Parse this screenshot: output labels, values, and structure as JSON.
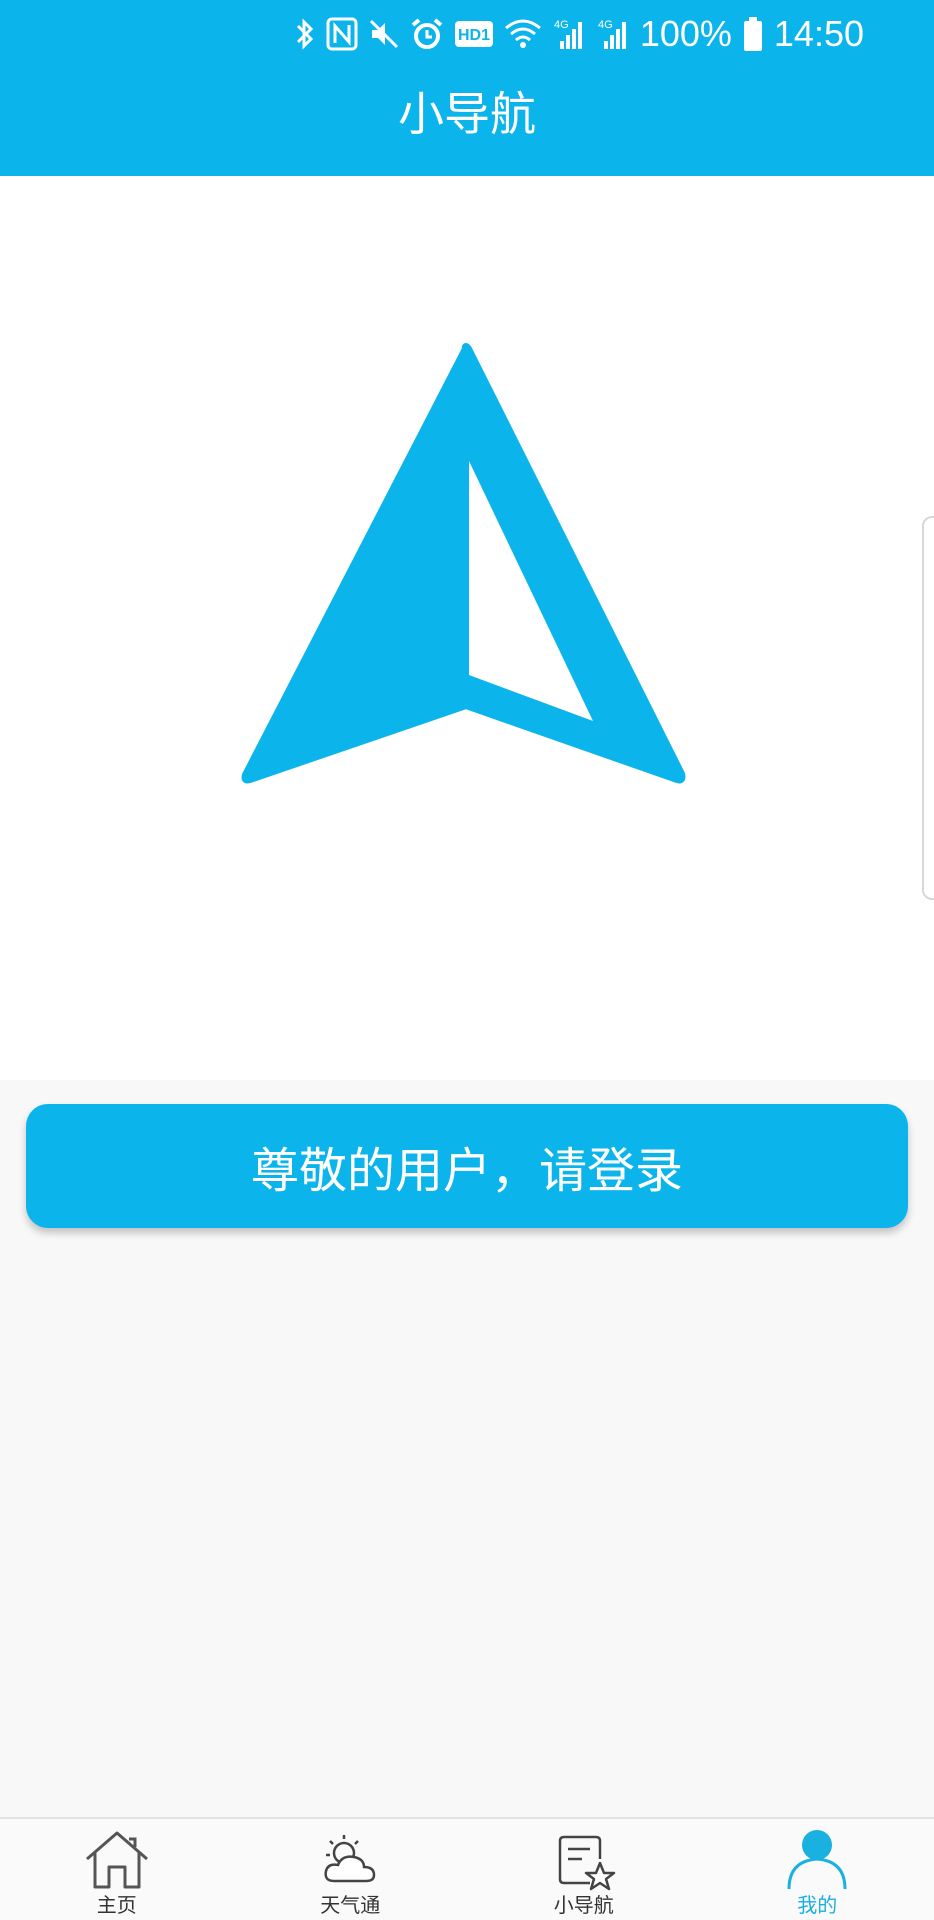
{
  "status_bar": {
    "battery_percent": "100%",
    "time": "14:50",
    "hd_label": "HD1",
    "network_labels": [
      "4G",
      "4G"
    ]
  },
  "header": {
    "title": "小导航"
  },
  "main": {
    "login_button_label": "尊敬的用户，请登录"
  },
  "bottom_nav": {
    "items": [
      {
        "label": "主页",
        "icon": "home-icon",
        "active": false
      },
      {
        "label": "天气通",
        "icon": "weather-icon",
        "active": false
      },
      {
        "label": "小导航",
        "icon": "navigation-icon",
        "active": false
      },
      {
        "label": "我的",
        "icon": "user-icon",
        "active": true
      }
    ]
  },
  "colors": {
    "primary": "#0bb4ea",
    "active_tab": "#1ab0e0",
    "background": "#f8f8f8"
  }
}
